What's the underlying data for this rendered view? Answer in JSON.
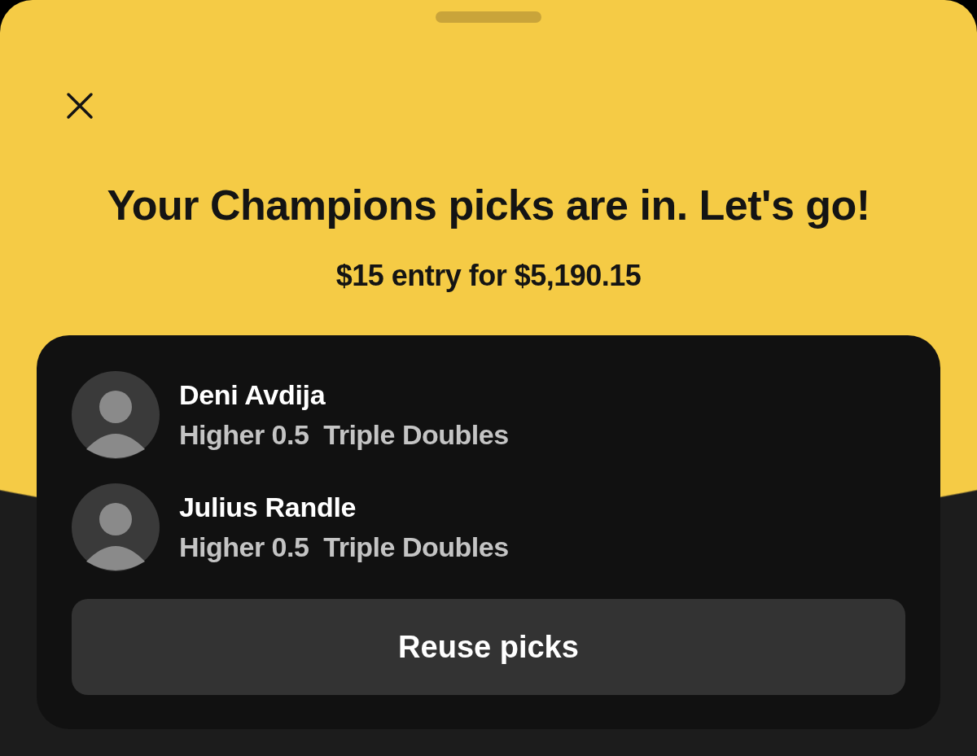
{
  "sheet": {
    "title": "Your Champions picks are in. Let's go!",
    "subtitle": "$15 entry for $5,190.15"
  },
  "picks": [
    {
      "player": "Deni Avdija",
      "detail": "Higher 0.5  Triple Doubles"
    },
    {
      "player": "Julius Randle",
      "detail": "Higher 0.5  Triple Doubles"
    }
  ],
  "button": "Reuse picks"
}
